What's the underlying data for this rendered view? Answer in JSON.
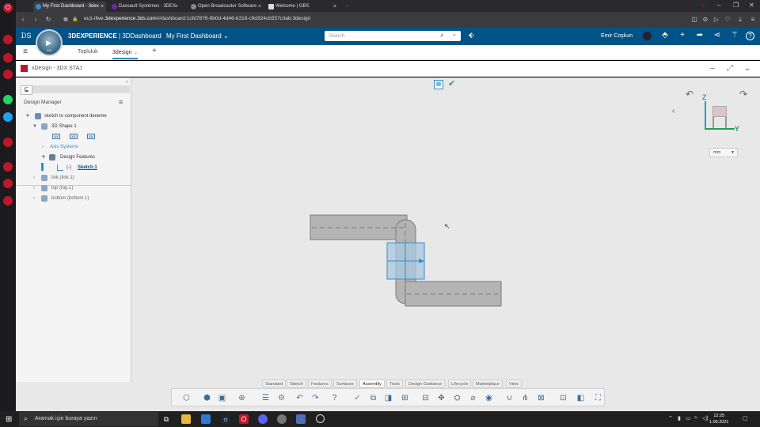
{
  "browser": {
    "tabs": [
      {
        "label": "My First Dashboard - 3dex"
      },
      {
        "label": "Dassault Systèmes : 3DEX"
      },
      {
        "label": "Open Broadcaster Software"
      },
      {
        "label": "Welcome | OBS"
      }
    ],
    "new_tab": "+",
    "url_prefix": "eu1-ifwe.",
    "url_domain": "3dexperience.3ds.com",
    "url_suffix": "/#dashboard:1cfd7876-9b0d-4d46-b318-c9d324cb557c/tab:3design",
    "back_glyph": "‹",
    "forward_glyph": "›",
    "reload_glyph": "↻"
  },
  "app_bar": {
    "brand_bold": "3DEXPERIENCE",
    "brand_sep": " | ",
    "brand_app": "3DDashboard",
    "dashboard_name": "My First Dashboard",
    "search_placeholder": "Search",
    "user_name": "Emir Coşkun"
  },
  "compass": {
    "label": "V,R"
  },
  "dashboard_tabs": {
    "items": [
      {
        "label": "Topluluk"
      },
      {
        "label": "3design"
      }
    ],
    "add": "+"
  },
  "app": {
    "title": "xDesign - 3DX STAJ"
  },
  "design_manager": {
    "title": "Design Manager",
    "tree": {
      "root": "sketch to component deneme",
      "shape": "3D Shape 1",
      "planes": [
        "XY",
        "YZ",
        "ZX"
      ],
      "axis_systems": "Axis Systems",
      "design_features": "Design Features",
      "sketch": "Sketch.1",
      "sketch_prefix": "(-)",
      "link": "link (link.1)",
      "top": "top (top.1)",
      "bottom": "bottom (bottom.1)"
    }
  },
  "compass_cube": {
    "z_label": "Z",
    "y_label": "Y"
  },
  "units": {
    "selected": "mm"
  },
  "command_tabs": [
    {
      "label": "Standard"
    },
    {
      "label": "Sketch"
    },
    {
      "label": "Features"
    },
    {
      "label": "Surfaces"
    },
    {
      "label": "Assembly"
    },
    {
      "label": "Tools"
    },
    {
      "label": "Design Guidance"
    },
    {
      "label": "Lifecycle"
    },
    {
      "label": "Marketplace"
    },
    {
      "label": "View"
    }
  ],
  "taskbar": {
    "search_placeholder": "Aramak için buraya yazın",
    "time": "12:25",
    "date": "1.09.2021"
  },
  "colors": {
    "app_bar": "#005386",
    "accent": "#368ec4",
    "viewport": "#e8e8e8",
    "part_fill": "#b4b4b4",
    "selection": "#a9c7e0"
  }
}
